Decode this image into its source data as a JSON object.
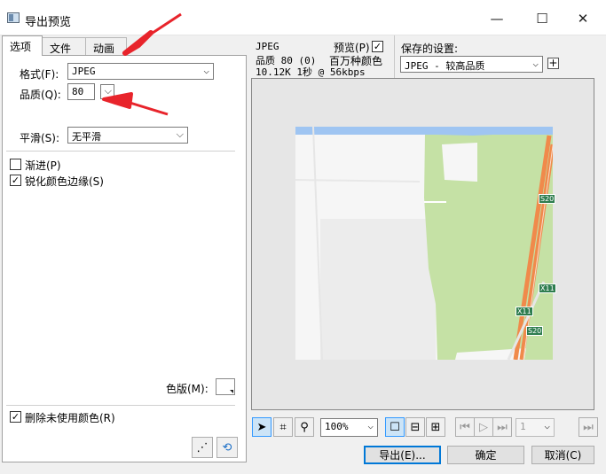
{
  "window": {
    "title": "导出预览",
    "minimize": "—",
    "maximize": "☐",
    "close": "✕"
  },
  "tabs": [
    {
      "label": "选项"
    },
    {
      "label": "文件"
    },
    {
      "label": "动画"
    }
  ],
  "options": {
    "format_label": "格式(F):",
    "format_value": "JPEG",
    "quality_label": "品质(Q):",
    "quality_value": "80",
    "smoothing_label": "平滑(S):",
    "smoothing_value": "无平滑",
    "progressive_label": "渐进(P)",
    "progressive_checked": false,
    "sharpen_label": "锐化颜色边缘(S)",
    "sharpen_checked": true,
    "matte_label": "色版(M):",
    "remove_unused_label": "删除未使用颜色(R)",
    "remove_unused_checked": true
  },
  "preview_info": {
    "line1": "JPEG",
    "line2": "品质 80 (0)",
    "line3": "10.12K  1秒 @ 56kbps",
    "preview_label": "预览(P)",
    "preview_checked": true,
    "colors_label": "百万种颜色",
    "saved_settings_label": "保存的设置:",
    "saved_settings_value": "JPEG - 较高品质",
    "add_button": "+"
  },
  "map_labels": {
    "road1": "S20",
    "road2": "X11",
    "road3": "X11",
    "road4": "S20"
  },
  "toolbar": {
    "zoom_value": "100%",
    "frame_value": "1"
  },
  "buttons": {
    "export": "导出(E)...",
    "ok": "确定",
    "cancel": "取消(C)"
  },
  "colors": {
    "annotation_arrow": "#e8242b",
    "map_green": "#c5e1a5",
    "road_orange": "#f08a4b",
    "river_blue": "#9fc5f2"
  }
}
